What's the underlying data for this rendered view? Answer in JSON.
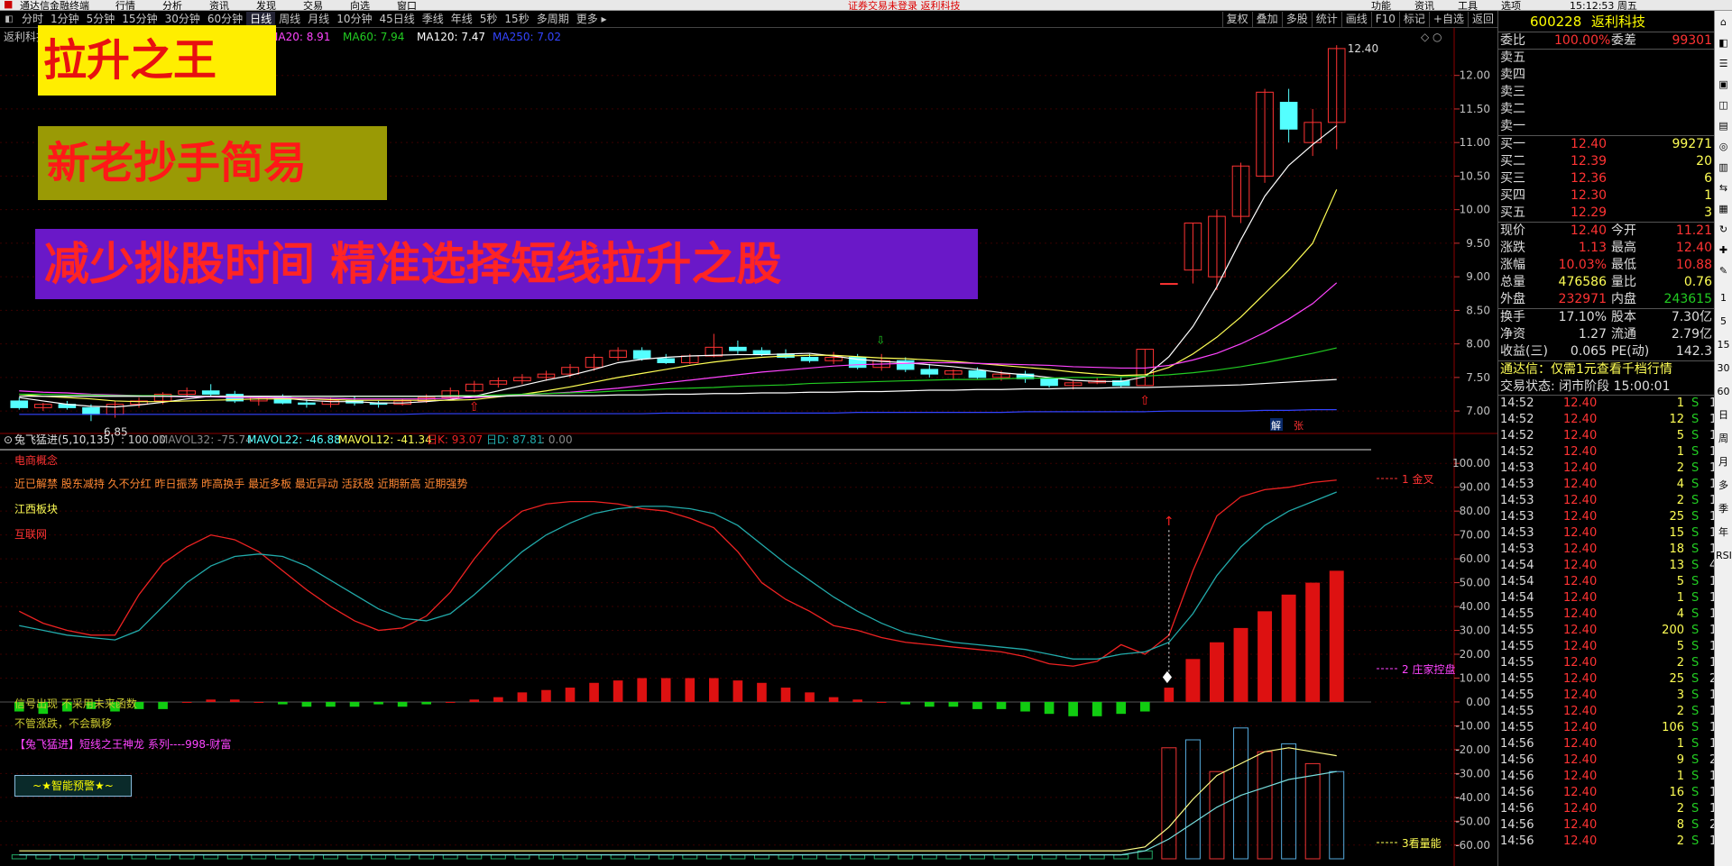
{
  "titlebar": {
    "app": "通达信金融终端",
    "menus": [
      "行情",
      "分析",
      "资讯",
      "发现",
      "交易",
      "向选",
      "窗口"
    ],
    "notice": "证券交易未登录  返利科技",
    "right_items": [
      "功能",
      "资讯",
      "工具",
      "选项"
    ],
    "clock": "15:12:53 周五"
  },
  "toolbar": {
    "periods": [
      "分时",
      "1分钟",
      "5分钟",
      "15分钟",
      "30分钟",
      "60分钟",
      "日线",
      "周线",
      "月线",
      "10分钟",
      "45日线",
      "季线",
      "年线",
      "5秒",
      "15秒",
      "多周期",
      "更多 ▸"
    ],
    "active_period": "日线",
    "tools": [
      "复权",
      "叠加",
      "多股",
      "统计",
      "画线",
      "F10",
      "标记",
      "+自选",
      "返回"
    ]
  },
  "ma_bar": {
    "name": "返利科技",
    "ma20": "MA20: 8.91",
    "ma60": "MA60: 7.94",
    "ma120": "MA120: 7.47",
    "ma250": "MA250: 7.02"
  },
  "banners": {
    "b1": "拉升之王",
    "b2": "新老抄手简易",
    "b3": "减少挑股时间   精准选择短线拉升之股"
  },
  "colors": {
    "up": "#ff3333",
    "down": "#54ffff",
    "ma5": "#ffffff",
    "ma10": "#ffff55",
    "ma20": "#ff44ff",
    "ma60": "#22cc22",
    "ma120": "#ffffff",
    "ma250": "#3344ff",
    "k_line": "#ee2222",
    "d_line": "#22aaaa"
  },
  "main_chart": {
    "y_ticks": [
      "12.00",
      "11.50",
      "11.00",
      "10.50",
      "10.00",
      "9.50",
      "9.00",
      "8.50",
      "8.00",
      "7.50",
      "7.00"
    ],
    "high_label": "12.40",
    "low_label": "6.85",
    "badges": [
      "解",
      "张"
    ]
  },
  "indicator": {
    "header": {
      "title": "兔飞猛进(5,10,135)",
      "v0": ": 100.00",
      "v1": "MAVOL32: -75.74",
      "v2": "MAVOL22: -46.88",
      "v3": "MAVOL12: -41.34",
      "v4": "日K: 93.07",
      "v5": "日D: 87.81",
      "v6": ": 0.00"
    },
    "concept": "电商概念",
    "tags": "近已解禁 股东减持 久不分红 昨日振荡 昨高换手 最近多板 最近异动 活跃股 近期新高 近期强势",
    "sector": "江西板块",
    "net": "互联网",
    "note1": "信号出现  不采用未来函数",
    "note2": "不管涨跌，不会飘移",
    "series": "【兔飞猛进】短线之王神龙 系列----998-财富",
    "alert": "~★智能预警★~",
    "y_ticks": [
      "100.00",
      "90.00",
      "80.00",
      "70.00",
      "60.00",
      "50.00",
      "40.00",
      "30.00",
      "20.00",
      "10.00",
      "0.00",
      "-10.00",
      "-20.00",
      "-30.00",
      "-40.00",
      "-50.00",
      "-60.00"
    ],
    "labels": {
      "gold": "1 金叉",
      "control": "2 庄家控盘",
      "volume": "3看量能"
    }
  },
  "chart_data": {
    "type": "candlestick",
    "title": "返利科技",
    "ohlc": [
      [
        7.15,
        7.2,
        7.02,
        7.05
      ],
      [
        7.05,
        7.12,
        7.0,
        7.1
      ],
      [
        7.1,
        7.15,
        7.02,
        7.05
      ],
      [
        7.05,
        7.1,
        6.85,
        6.95
      ],
      [
        6.95,
        7.15,
        6.9,
        7.1
      ],
      [
        7.1,
        7.2,
        7.05,
        7.15
      ],
      [
        7.15,
        7.28,
        7.1,
        7.25
      ],
      [
        7.25,
        7.35,
        7.2,
        7.3
      ],
      [
        7.3,
        7.4,
        7.22,
        7.25
      ],
      [
        7.25,
        7.3,
        7.12,
        7.15
      ],
      [
        7.15,
        7.22,
        7.08,
        7.2
      ],
      [
        7.2,
        7.25,
        7.1,
        7.12
      ],
      [
        7.12,
        7.18,
        7.05,
        7.1
      ],
      [
        7.1,
        7.2,
        7.05,
        7.15
      ],
      [
        7.15,
        7.22,
        7.08,
        7.12
      ],
      [
        7.12,
        7.15,
        7.05,
        7.1
      ],
      [
        7.1,
        7.18,
        7.08,
        7.15
      ],
      [
        7.15,
        7.25,
        7.12,
        7.2
      ],
      [
        7.2,
        7.35,
        7.18,
        7.3
      ],
      [
        7.3,
        7.45,
        7.28,
        7.4
      ],
      [
        7.4,
        7.5,
        7.35,
        7.45
      ],
      [
        7.45,
        7.55,
        7.4,
        7.5
      ],
      [
        7.5,
        7.6,
        7.45,
        7.55
      ],
      [
        7.55,
        7.7,
        7.5,
        7.65
      ],
      [
        7.65,
        7.85,
        7.6,
        7.8
      ],
      [
        7.8,
        7.95,
        7.75,
        7.9
      ],
      [
        7.9,
        7.95,
        7.75,
        7.78
      ],
      [
        7.78,
        7.85,
        7.7,
        7.72
      ],
      [
        7.72,
        7.85,
        7.7,
        7.82
      ],
      [
        7.82,
        8.15,
        7.8,
        7.95
      ],
      [
        7.95,
        8.05,
        7.85,
        7.9
      ],
      [
        7.9,
        7.95,
        7.82,
        7.85
      ],
      [
        7.85,
        7.92,
        7.78,
        7.8
      ],
      [
        7.8,
        7.85,
        7.72,
        7.75
      ],
      [
        7.75,
        7.88,
        7.7,
        7.8
      ],
      [
        7.8,
        7.85,
        7.62,
        7.65
      ],
      [
        7.65,
        7.85,
        7.6,
        7.75
      ],
      [
        7.75,
        7.8,
        7.58,
        7.62
      ],
      [
        7.62,
        7.7,
        7.5,
        7.55
      ],
      [
        7.55,
        7.62,
        7.48,
        7.6
      ],
      [
        7.6,
        7.65,
        7.48,
        7.5
      ],
      [
        7.5,
        7.6,
        7.45,
        7.55
      ],
      [
        7.55,
        7.6,
        7.42,
        7.48
      ],
      [
        7.48,
        7.5,
        7.35,
        7.38
      ],
      [
        7.38,
        7.45,
        7.32,
        7.42
      ],
      [
        7.42,
        7.5,
        7.4,
        7.45
      ],
      [
        7.45,
        7.5,
        7.35,
        7.38
      ],
      [
        7.38,
        7.92,
        7.38,
        7.92
      ],
      [
        8.9,
        8.9,
        8.9,
        8.9
      ],
      [
        9.1,
        9.8,
        8.9,
        9.8
      ],
      [
        9.0,
        10.0,
        8.8,
        9.9
      ],
      [
        9.9,
        10.7,
        9.8,
        10.65
      ],
      [
        10.5,
        11.8,
        10.4,
        11.75
      ],
      [
        11.6,
        11.8,
        11.0,
        11.2
      ],
      [
        11.0,
        11.5,
        10.8,
        11.3
      ],
      [
        11.3,
        12.45,
        10.9,
        12.4
      ]
    ],
    "ma5": [
      7.2,
      7.15,
      7.1,
      7.07,
      7.06,
      7.09,
      7.13,
      7.18,
      7.22,
      7.22,
      7.21,
      7.19,
      7.16,
      7.14,
      7.14,
      7.12,
      7.12,
      7.14,
      7.17,
      7.22,
      7.3,
      7.38,
      7.46,
      7.53,
      7.62,
      7.72,
      7.77,
      7.8,
      7.82,
      7.83,
      7.84,
      7.84,
      7.85,
      7.86,
      7.82,
      7.77,
      7.74,
      7.72,
      7.69,
      7.66,
      7.62,
      7.57,
      7.54,
      7.5,
      7.46,
      7.44,
      7.44,
      7.51,
      7.81,
      8.26,
      8.85,
      9.55,
      10.2,
      10.66,
      10.97,
      11.25
    ],
    "ma10": [
      7.25,
      7.22,
      7.2,
      7.18,
      7.15,
      7.14,
      7.14,
      7.15,
      7.16,
      7.17,
      7.18,
      7.18,
      7.18,
      7.17,
      7.16,
      7.16,
      7.16,
      7.16,
      7.16,
      7.17,
      7.21,
      7.25,
      7.3,
      7.36,
      7.43,
      7.5,
      7.56,
      7.62,
      7.68,
      7.73,
      7.77,
      7.8,
      7.82,
      7.83,
      7.83,
      7.81,
      7.79,
      7.78,
      7.76,
      7.74,
      7.71,
      7.68,
      7.65,
      7.62,
      7.58,
      7.55,
      7.53,
      7.54,
      7.65,
      7.85,
      8.1,
      8.4,
      8.75,
      9.1,
      9.5,
      10.3
    ],
    "ma20": [
      7.3,
      7.28,
      7.27,
      7.25,
      7.24,
      7.23,
      7.22,
      7.21,
      7.21,
      7.2,
      7.2,
      7.2,
      7.19,
      7.19,
      7.18,
      7.18,
      7.18,
      7.18,
      7.19,
      7.2,
      7.22,
      7.24,
      7.26,
      7.28,
      7.31,
      7.34,
      7.38,
      7.42,
      7.46,
      7.5,
      7.54,
      7.58,
      7.61,
      7.64,
      7.67,
      7.69,
      7.7,
      7.71,
      7.72,
      7.72,
      7.71,
      7.7,
      7.69,
      7.68,
      7.66,
      7.65,
      7.64,
      7.64,
      7.68,
      7.76,
      7.86,
      8.0,
      8.17,
      8.37,
      8.6,
      8.91
    ],
    "ma60": [
      7.25,
      7.25,
      7.24,
      7.24,
      7.23,
      7.23,
      7.23,
      7.22,
      7.22,
      7.22,
      7.22,
      7.22,
      7.22,
      7.22,
      7.22,
      7.22,
      7.22,
      7.22,
      7.23,
      7.23,
      7.24,
      7.25,
      7.26,
      7.27,
      7.28,
      7.3,
      7.31,
      7.33,
      7.34,
      7.35,
      7.37,
      7.38,
      7.39,
      7.41,
      7.42,
      7.43,
      7.44,
      7.45,
      7.46,
      7.47,
      7.47,
      7.48,
      7.49,
      7.49,
      7.5,
      7.5,
      7.51,
      7.52,
      7.54,
      7.57,
      7.61,
      7.66,
      7.72,
      7.79,
      7.86,
      7.94
    ],
    "ma120": [
      7.22,
      7.22,
      7.22,
      7.22,
      7.22,
      7.22,
      7.22,
      7.22,
      7.22,
      7.22,
      7.22,
      7.22,
      7.22,
      7.22,
      7.22,
      7.22,
      7.22,
      7.22,
      7.22,
      7.22,
      7.22,
      7.23,
      7.23,
      7.23,
      7.23,
      7.24,
      7.24,
      7.25,
      7.25,
      7.26,
      7.26,
      7.27,
      7.27,
      7.28,
      7.28,
      7.29,
      7.29,
      7.3,
      7.31,
      7.31,
      7.32,
      7.32,
      7.33,
      7.33,
      7.34,
      7.34,
      7.35,
      7.35,
      7.36,
      7.37,
      7.38,
      7.39,
      7.41,
      7.43,
      7.45,
      7.47
    ],
    "ma250": [
      6.95,
      6.95,
      6.95,
      6.95,
      6.95,
      6.95,
      6.95,
      6.95,
      6.95,
      6.95,
      6.95,
      6.95,
      6.95,
      6.95,
      6.95,
      6.95,
      6.95,
      6.96,
      6.96,
      6.96,
      6.96,
      6.96,
      6.96,
      6.96,
      6.96,
      6.96,
      6.96,
      6.97,
      6.97,
      6.97,
      6.97,
      6.97,
      6.97,
      6.97,
      6.97,
      6.98,
      6.98,
      6.98,
      6.98,
      6.98,
      6.98,
      6.98,
      6.99,
      6.99,
      6.99,
      6.99,
      6.99,
      6.99,
      7.0,
      7.0,
      7.0,
      7.0,
      7.01,
      7.01,
      7.02,
      7.02
    ],
    "k_line": [
      38,
      33,
      30,
      28,
      28,
      45,
      58,
      65,
      70,
      68,
      63,
      55,
      47,
      40,
      34,
      30,
      31,
      36,
      46,
      60,
      72,
      80,
      83,
      84,
      84,
      83,
      81,
      80,
      77,
      73,
      63,
      50,
      43,
      38,
      32,
      30,
      27,
      25,
      24,
      23,
      22,
      21,
      19,
      16,
      15,
      17,
      24,
      20,
      28,
      55,
      78,
      86,
      89,
      90,
      92,
      93
    ],
    "d_line": [
      32,
      30,
      28,
      27,
      26,
      30,
      40,
      50,
      57,
      61,
      62,
      61,
      57,
      51,
      45,
      39,
      35,
      34,
      37,
      45,
      54,
      63,
      70,
      75,
      79,
      81,
      82,
      82,
      81,
      79,
      74,
      66,
      58,
      51,
      44,
      38,
      33,
      29,
      27,
      25,
      24,
      23,
      22,
      20,
      18,
      18,
      20,
      21,
      25,
      37,
      53,
      65,
      74,
      80,
      84,
      88
    ],
    "control": [
      -4,
      -5,
      -4,
      -3,
      -4,
      -3,
      -3,
      0,
      1,
      1,
      0,
      -1,
      -2,
      -2,
      -2,
      -1,
      -2,
      -1,
      0,
      1,
      2,
      4,
      5,
      6,
      8,
      9,
      10,
      10,
      10,
      10,
      9,
      8,
      6,
      4,
      2,
      1,
      0,
      -1,
      -2,
      -2,
      -3,
      -3,
      -4,
      -5,
      -6,
      -6,
      -5,
      -4,
      6,
      18,
      25,
      31,
      38,
      45,
      50,
      55
    ],
    "vol_up_idx": [
      48,
      49,
      50,
      51,
      52,
      53,
      54,
      55
    ],
    "vol": [
      1,
      1,
      1,
      1,
      1,
      1,
      1,
      1,
      1,
      1,
      1,
      1,
      1,
      1,
      1,
      1,
      1,
      1,
      1,
      1,
      1,
      1,
      1,
      1,
      1,
      1,
      1,
      1,
      1,
      1,
      1,
      1,
      1,
      1,
      1,
      1,
      1,
      1,
      1,
      1,
      1,
      1,
      1,
      1,
      1,
      1,
      1,
      2,
      28,
      30,
      22,
      33,
      27,
      29,
      24,
      22
    ],
    "vol_ma1": [
      2,
      2,
      2,
      2,
      2,
      2,
      2,
      2,
      2,
      2,
      2,
      2,
      2,
      2,
      2,
      2,
      2,
      2,
      2,
      2,
      2,
      2,
      2,
      2,
      2,
      2,
      2,
      2,
      2,
      2,
      2,
      2,
      2,
      2,
      2,
      2,
      2,
      2,
      2,
      2,
      2,
      2,
      2,
      2,
      2,
      2,
      2,
      3,
      8,
      15,
      21,
      24,
      27,
      28,
      27,
      26
    ],
    "vol_ma2": [
      1,
      1,
      1,
      1,
      1,
      1,
      1,
      1,
      1,
      1,
      1,
      1,
      1,
      1,
      1,
      1,
      1,
      1,
      1,
      1,
      1,
      1,
      1,
      1,
      1,
      1,
      1,
      1,
      1,
      1,
      1,
      1,
      1,
      1,
      1,
      1,
      1,
      1,
      1,
      1,
      1,
      1,
      1,
      1,
      1,
      1,
      1,
      2,
      5,
      9,
      13,
      16,
      18,
      20,
      21,
      22
    ],
    "ylim": [
      6.8,
      12.6
    ],
    "ylim_ind": [
      -65,
      105
    ]
  },
  "quote": {
    "code": "600228",
    "name": "返利科技",
    "wb_label": "委比",
    "wb_val": "100.00%",
    "wc_label": "委差",
    "wc_val": "99301",
    "asks": [
      {
        "l": "卖五"
      },
      {
        "l": "卖四"
      },
      {
        "l": "卖三"
      },
      {
        "l": "卖二"
      },
      {
        "l": "卖一"
      }
    ],
    "bids": [
      {
        "l": "买一",
        "p": "12.40",
        "v": "99271"
      },
      {
        "l": "买二",
        "p": "12.39",
        "v": "20"
      },
      {
        "l": "买三",
        "p": "12.36",
        "v": "6"
      },
      {
        "l": "买四",
        "p": "12.30",
        "v": "1"
      },
      {
        "l": "买五",
        "p": "12.29",
        "v": "3"
      }
    ],
    "stats": [
      {
        "l1": "现价",
        "v1": "12.40",
        "l2": "今开",
        "v2": "11.21"
      },
      {
        "l1": "涨跌",
        "v1": "1.13",
        "l2": "最高",
        "v2": "12.40"
      },
      {
        "l1": "涨幅",
        "v1": "10.03%",
        "l2": "最低",
        "v2": "10.88"
      },
      {
        "l1": "总量",
        "v1": "476586",
        "l2": "量比",
        "v2": "0.76"
      },
      {
        "l1": "外盘",
        "v1": "232971",
        "l2": "内盘",
        "v2": "243615"
      }
    ],
    "fin": [
      {
        "l1": "换手",
        "v1": "17.10%",
        "l2": "股本",
        "v2": "7.30亿"
      },
      {
        "l1": "净资",
        "v1": "1.27",
        "l2": "流通",
        "v2": "2.79亿"
      },
      {
        "l1": "收益(三)",
        "v1": "0.065",
        "l2": "PE(动)",
        "v2": "142.3"
      }
    ],
    "ad": "通达信：仅需1元查看千档行情",
    "status": "交易状态: 闭市阶段 15:00:01",
    "ticks": [
      [
        "14:52",
        "12.40",
        "1",
        "S",
        "1"
      ],
      [
        "14:52",
        "12.40",
        "12",
        "S",
        "1"
      ],
      [
        "14:52",
        "12.40",
        "5",
        "S",
        "1"
      ],
      [
        "14:52",
        "12.40",
        "1",
        "S",
        "1"
      ],
      [
        "14:53",
        "12.40",
        "2",
        "S",
        "1"
      ],
      [
        "14:53",
        "12.40",
        "4",
        "S",
        "1"
      ],
      [
        "14:53",
        "12.40",
        "2",
        "S",
        "1"
      ],
      [
        "14:53",
        "12.40",
        "25",
        "S",
        "1"
      ],
      [
        "14:53",
        "12.40",
        "15",
        "S",
        "1"
      ],
      [
        "14:53",
        "12.40",
        "18",
        "S",
        "1"
      ],
      [
        "14:54",
        "12.40",
        "13",
        "S",
        "4"
      ],
      [
        "14:54",
        "12.40",
        "5",
        "S",
        "1"
      ],
      [
        "14:54",
        "12.40",
        "1",
        "S",
        "1"
      ],
      [
        "14:55",
        "12.40",
        "4",
        "S",
        "1"
      ],
      [
        "14:55",
        "12.40",
        "200",
        "S",
        "1"
      ],
      [
        "14:55",
        "12.40",
        "5",
        "S",
        "1"
      ],
      [
        "14:55",
        "12.40",
        "2",
        "S",
        "1"
      ],
      [
        "14:55",
        "12.40",
        "25",
        "S",
        "2"
      ],
      [
        "14:55",
        "12.40",
        "3",
        "S",
        "1"
      ],
      [
        "14:55",
        "12.40",
        "2",
        "S",
        "1"
      ],
      [
        "14:55",
        "12.40",
        "106",
        "S",
        "1"
      ],
      [
        "14:56",
        "12.40",
        "1",
        "S",
        "1"
      ],
      [
        "14:56",
        "12.40",
        "9",
        "S",
        "2"
      ],
      [
        "14:56",
        "12.40",
        "1",
        "S",
        "1"
      ],
      [
        "14:56",
        "12.40",
        "16",
        "S",
        "1"
      ],
      [
        "14:56",
        "12.40",
        "2",
        "S",
        "1"
      ],
      [
        "14:56",
        "12.40",
        "8",
        "S",
        "2"
      ],
      [
        "14:56",
        "12.40",
        "2",
        "S",
        "1"
      ]
    ]
  },
  "right_sidebar": [
    "1",
    "5",
    "15",
    "30",
    "60",
    "日",
    "周",
    "月",
    "多",
    "季",
    "年",
    "RSI"
  ]
}
